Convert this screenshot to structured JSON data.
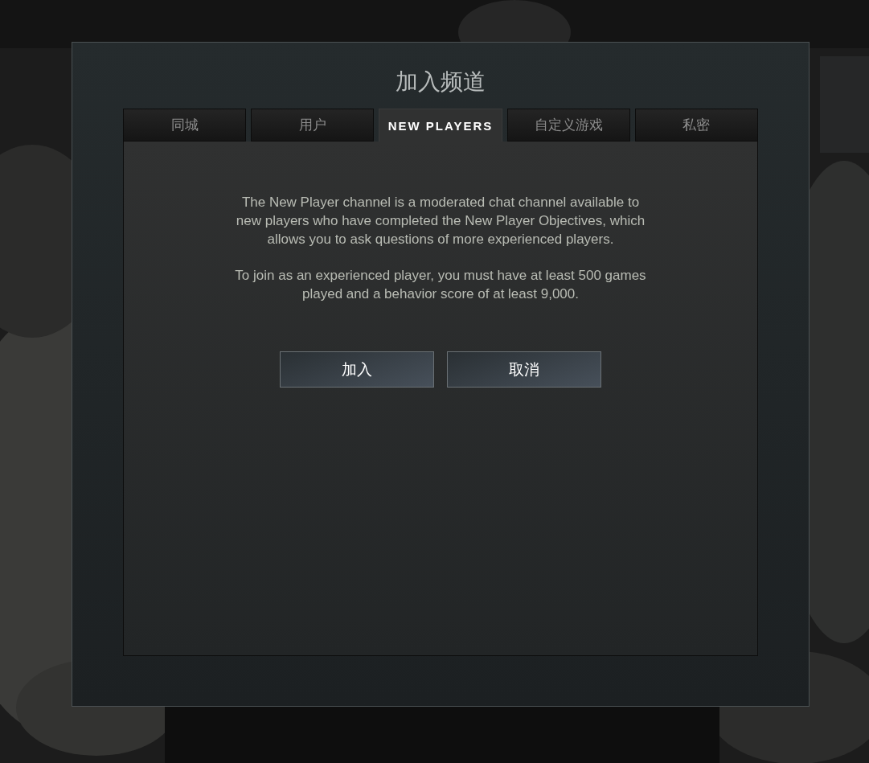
{
  "dialog": {
    "title": "加入频道",
    "tabs": [
      {
        "label": "同城",
        "selected": false
      },
      {
        "label": "用户",
        "selected": false
      },
      {
        "label": "NEW PLAYERS",
        "selected": true
      },
      {
        "label": "自定义游戏",
        "selected": false
      },
      {
        "label": "私密",
        "selected": false
      }
    ],
    "paragraphs": [
      "The New Player channel is a moderated chat channel available to new players who have completed the New Player Objectives, which allows you to ask questions of more experienced players.",
      "To join as an experienced player, you must have at least 500 games played and a behavior score of at least 9,000."
    ],
    "buttons": [
      "加入",
      "取消"
    ]
  }
}
